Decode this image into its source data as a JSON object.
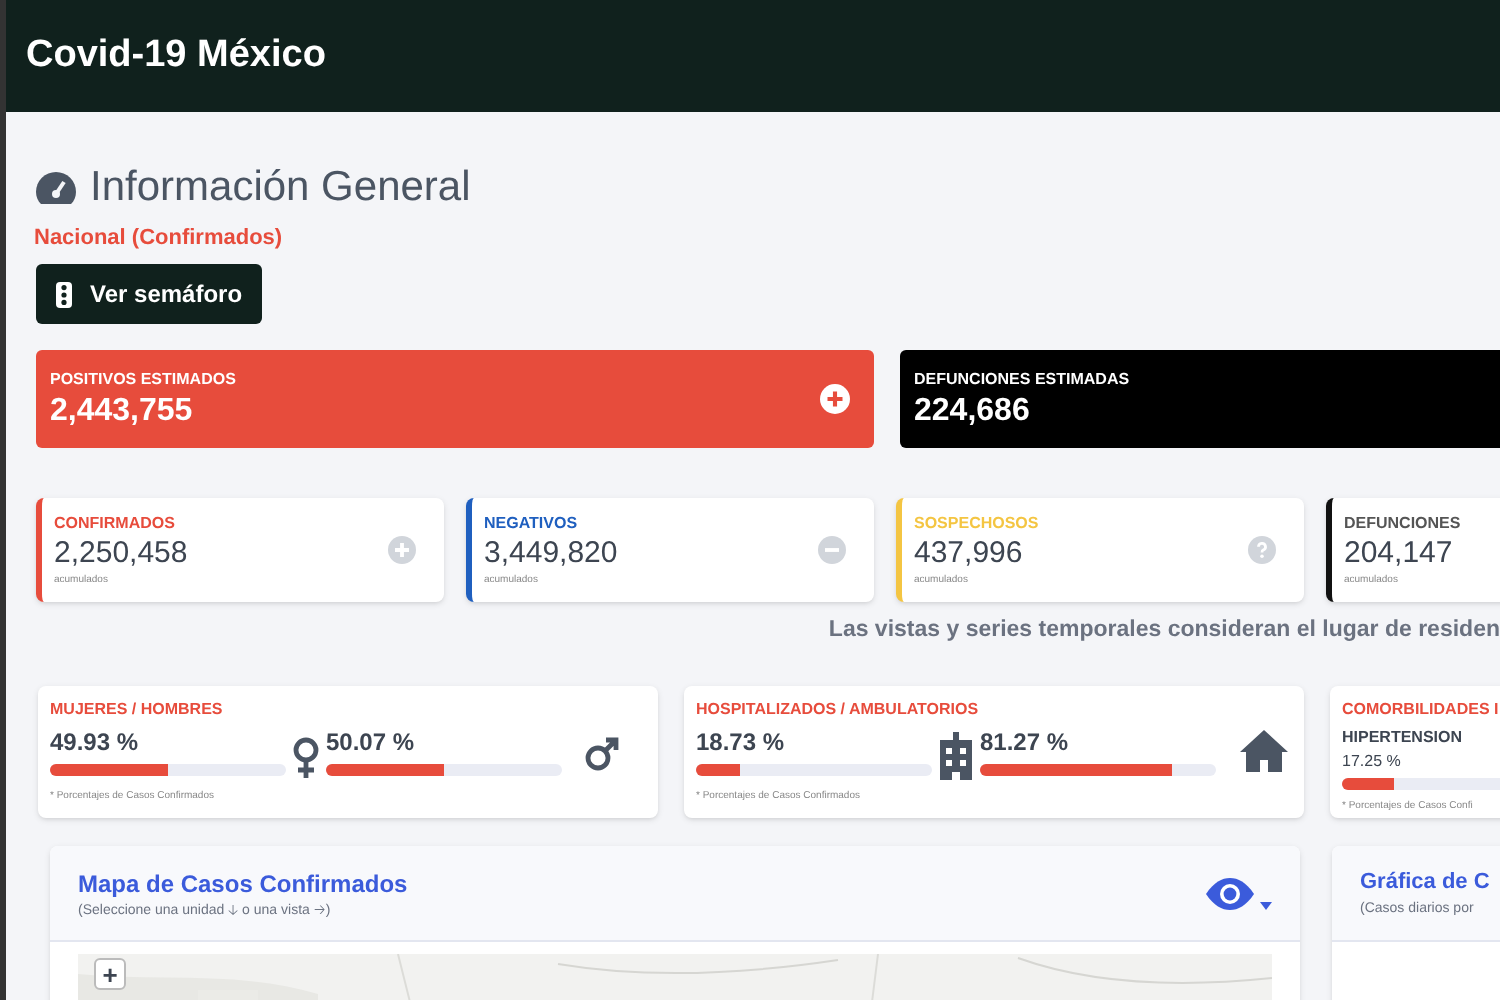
{
  "app_title": "Covid-19 México",
  "heading": {
    "title": "Información General",
    "subtitle": "Nacional (Confirmados)"
  },
  "semaforo_button": {
    "label": "Ver semáforo"
  },
  "estimates": [
    {
      "label": "POSITIVOS ESTIMADOS",
      "value": "2,443,755",
      "color": "#e74c3c",
      "kind": "plus"
    },
    {
      "label": "DEFUNCIONES ESTIMADAS",
      "value": "224,686",
      "color": "#000000",
      "kind": "none"
    }
  ],
  "totals": [
    {
      "label": "CONFIRMADOS",
      "value": "2,250,458",
      "note": "acumulados",
      "color": "#e74c3c",
      "kind": "plus"
    },
    {
      "label": "NEGATIVOS",
      "value": "3,449,820",
      "note": "acumulados",
      "color": "#1f5fbf",
      "kind": "minus"
    },
    {
      "label": "SOSPECHOSOS",
      "value": "437,996",
      "note": "acumulados",
      "color": "#f4c542",
      "kind": "question"
    },
    {
      "label": "DEFUNCIONES",
      "value": "204,147",
      "note": "acumulados",
      "color": "#111111",
      "kind": "none"
    }
  ],
  "residence_note": "Las vistas y series temporales consideran el lugar de residen",
  "ratios": [
    {
      "kind": "pair",
      "title": "MUJERES / HOMBRES",
      "note": "* Porcentajes de Casos Confirmados",
      "items": [
        {
          "reading": "49.93 %",
          "level": 0.4993
        },
        {
          "reading": "50.07 %",
          "level": 0.5007
        }
      ]
    },
    {
      "kind": "pair",
      "title": "HOSPITALIZADOS / AMBULATORIOS",
      "note": "* Porcentajes de Casos Confirmados",
      "items": [
        {
          "reading": "18.73 %",
          "level": 0.1873
        },
        {
          "reading": "81.27 %",
          "level": 0.8127
        }
      ]
    },
    {
      "kind": "list",
      "title": "COMORBILIDADES I",
      "note": "* Porcentajes de Casos Confi",
      "items": [
        {
          "label": "HIPERTENSION",
          "reading": "17.25 %",
          "level": 0.1725
        }
      ]
    }
  ],
  "map_card": {
    "title": "Mapa de Casos Confirmados",
    "subtitle": "(Seleccione una unidad 🡣 o una vista 🡢)",
    "zoom_in": "+"
  },
  "chart_card": {
    "title": "Gráfica de C",
    "subtitle": "(Casos diarios por"
  }
}
